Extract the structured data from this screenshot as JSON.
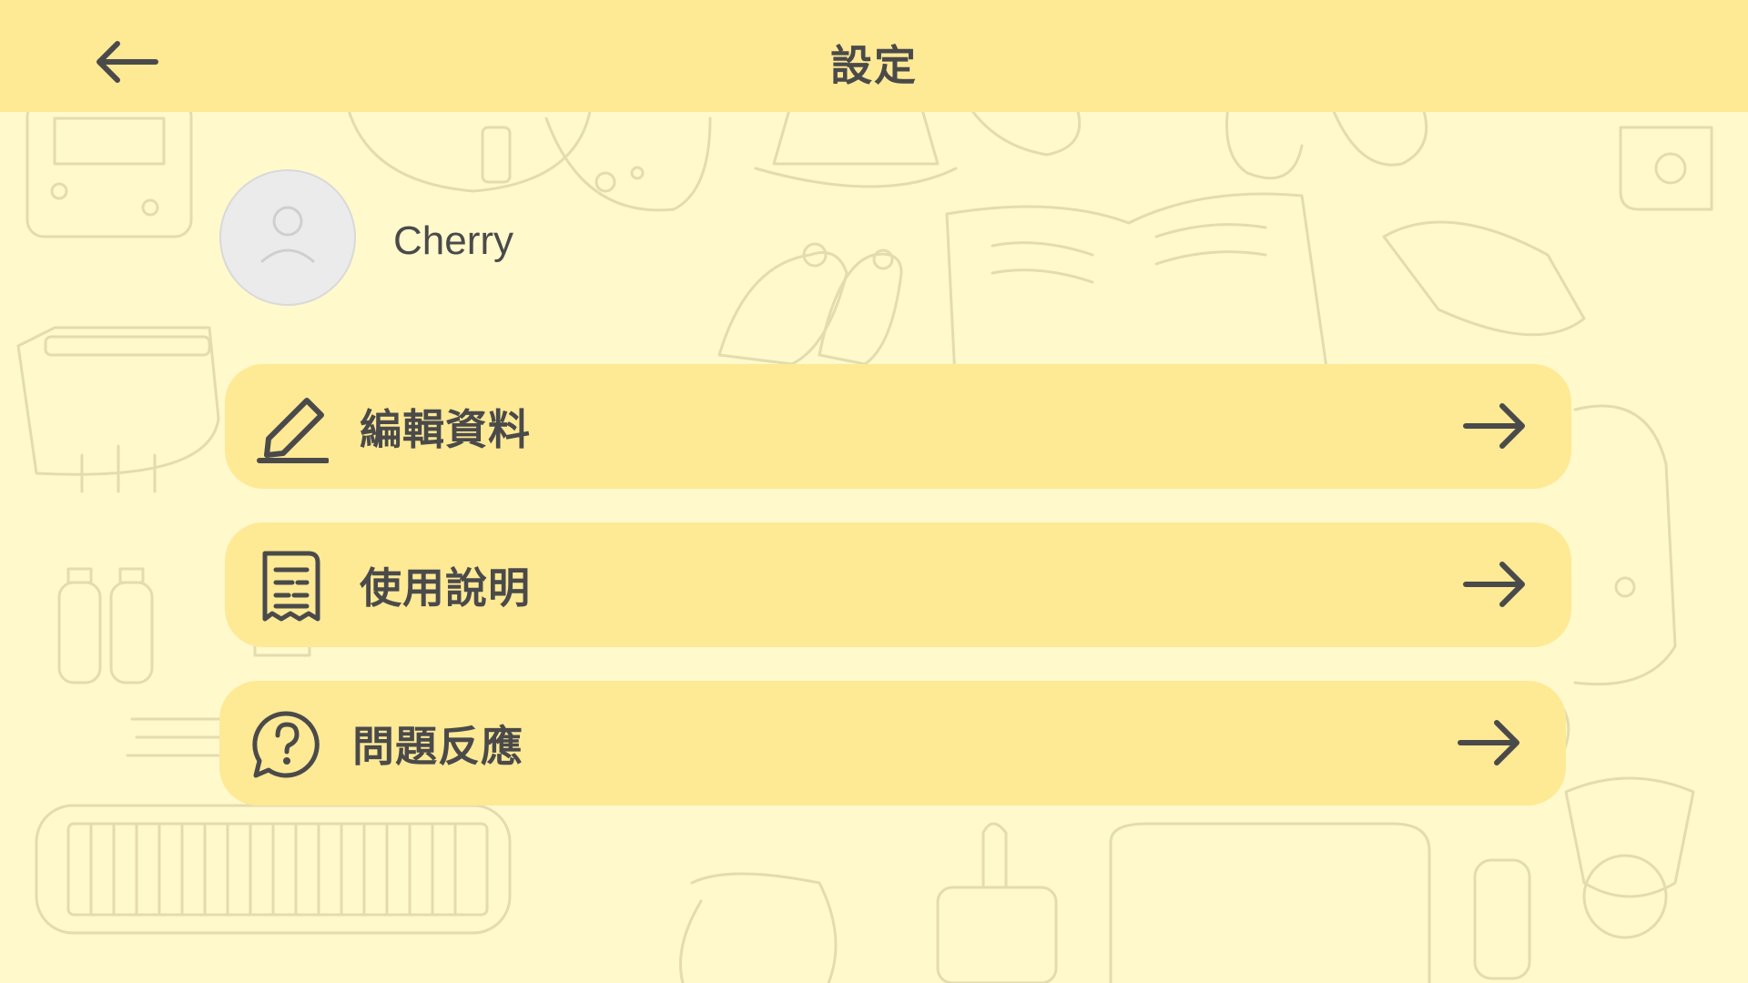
{
  "header": {
    "title": "設定",
    "back_icon": "arrow-left-icon"
  },
  "profile": {
    "name": "Cherry",
    "avatar_icon": "user-icon"
  },
  "menu": {
    "items": [
      {
        "label": "編輯資料",
        "icon": "pencil-icon",
        "arrow_icon": "arrow-right-icon"
      },
      {
        "label": "使用說明",
        "icon": "receipt-icon",
        "arrow_icon": "arrow-right-icon"
      },
      {
        "label": "問題反應",
        "icon": "question-bubble-icon",
        "arrow_icon": "arrow-right-icon"
      }
    ]
  },
  "colors": {
    "background": "#fff9cc",
    "header": "#fee995",
    "menu_item": "#fee995",
    "text": "#4a4a4a",
    "avatar": "#ebebeb"
  }
}
